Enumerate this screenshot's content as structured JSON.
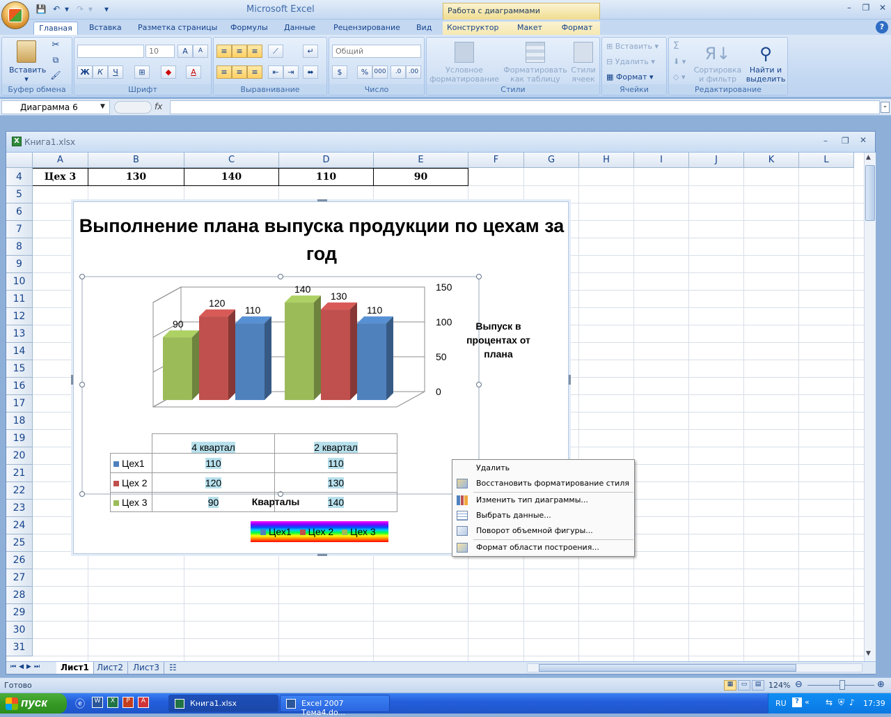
{
  "app": {
    "title": "Microsoft Excel",
    "context_title": "Работа с диаграммами"
  },
  "tabs": [
    {
      "label": "Главная"
    },
    {
      "label": "Вставка"
    },
    {
      "label": "Разметка страницы"
    },
    {
      "label": "Формулы"
    },
    {
      "label": "Данные"
    },
    {
      "label": "Рецензирование"
    },
    {
      "label": "Вид"
    },
    {
      "label": "Конструктор"
    },
    {
      "label": "Макет"
    },
    {
      "label": "Формат"
    }
  ],
  "ribbon": {
    "clipboard": {
      "label": "Буфер обмена",
      "paste": "Вставить"
    },
    "font": {
      "label": "Шрифт",
      "size": "10",
      "bold": "Ж",
      "italic": "К",
      "underline": "Ч"
    },
    "alignment": {
      "label": "Выравнивание"
    },
    "number": {
      "label": "Число",
      "format": "Общий",
      "percent": "%",
      "thousands": "000"
    },
    "styles": {
      "label": "Стили",
      "cond_format": "Условное форматирование",
      "as_table": "Форматировать как таблицу",
      "cell_styles": "Стили ячеек"
    },
    "cells": {
      "label": "Ячейки",
      "insert": "Вставить",
      "delete": "Удалить",
      "format": "Формат"
    },
    "editing": {
      "label": "Редактирование",
      "sigma": "Σ",
      "sort": "Сортировка и фильтр",
      "find": "Найти и выделить"
    }
  },
  "formula_bar": {
    "name_box": "Диаграмма 6",
    "fx": "fx",
    "value": ""
  },
  "workbook": {
    "title": "Книга1.xlsx"
  },
  "columns": [
    "A",
    "B",
    "C",
    "D",
    "E",
    "F",
    "G",
    "H",
    "I",
    "J",
    "K",
    "L"
  ],
  "rows": [
    "4",
    "5",
    "6",
    "7",
    "8",
    "9",
    "10",
    "11",
    "12",
    "13",
    "14",
    "15",
    "16",
    "17",
    "18",
    "19",
    "20",
    "21",
    "22",
    "23",
    "24",
    "25",
    "26",
    "27",
    "28",
    "29",
    "30",
    "31"
  ],
  "row4": [
    "Цех 3",
    "130",
    "140",
    "110",
    "90"
  ],
  "sheets": [
    "Лист1",
    "Лист2",
    "Лист3"
  ],
  "chart_data": {
    "type": "bar",
    "title": "Выполнение плана выпуска продукции по цехам за год",
    "categories": [
      "4 квартал",
      "2 квартал"
    ],
    "series": [
      {
        "name": "Цех1",
        "values": [
          110,
          110
        ],
        "color": "#4f81bd"
      },
      {
        "name": "Цех 2",
        "values": [
          120,
          130
        ],
        "color": "#c0504d"
      },
      {
        "name": "Цех 3",
        "values": [
          90,
          140
        ],
        "color": "#9bbb59"
      }
    ],
    "xlabel": "Кварталы",
    "ylabel": "Выпуск в процентах от плана",
    "ylim": [
      0,
      150
    ],
    "yticks": [
      "0",
      "50",
      "100",
      "150"
    ],
    "legend_items": [
      "Цех1",
      "Цех 2",
      "Цех 3"
    ],
    "legend_placement": "bottom",
    "data_table": true
  },
  "context_menu": [
    {
      "label": "Удалить",
      "icon": ""
    },
    {
      "label": "Восстановить форматирование стиля",
      "icon": "reset-style-icon"
    },
    {
      "label": "Изменить тип диаграммы...",
      "icon": "chart-type-icon"
    },
    {
      "label": "Выбрать данные...",
      "icon": "select-data-icon"
    },
    {
      "label": "Поворот объемной фигуры...",
      "icon": "3d-rotation-icon"
    },
    {
      "label": "Формат области построения...",
      "icon": "format-area-icon"
    }
  ],
  "status": {
    "ready": "Готово",
    "zoom": "124%"
  },
  "taskbar": {
    "start": "пуск",
    "items": [
      "Книга1.xlsx",
      "Excel 2007 Тема4.do..."
    ],
    "lang": "RU",
    "clock": "17:39"
  }
}
